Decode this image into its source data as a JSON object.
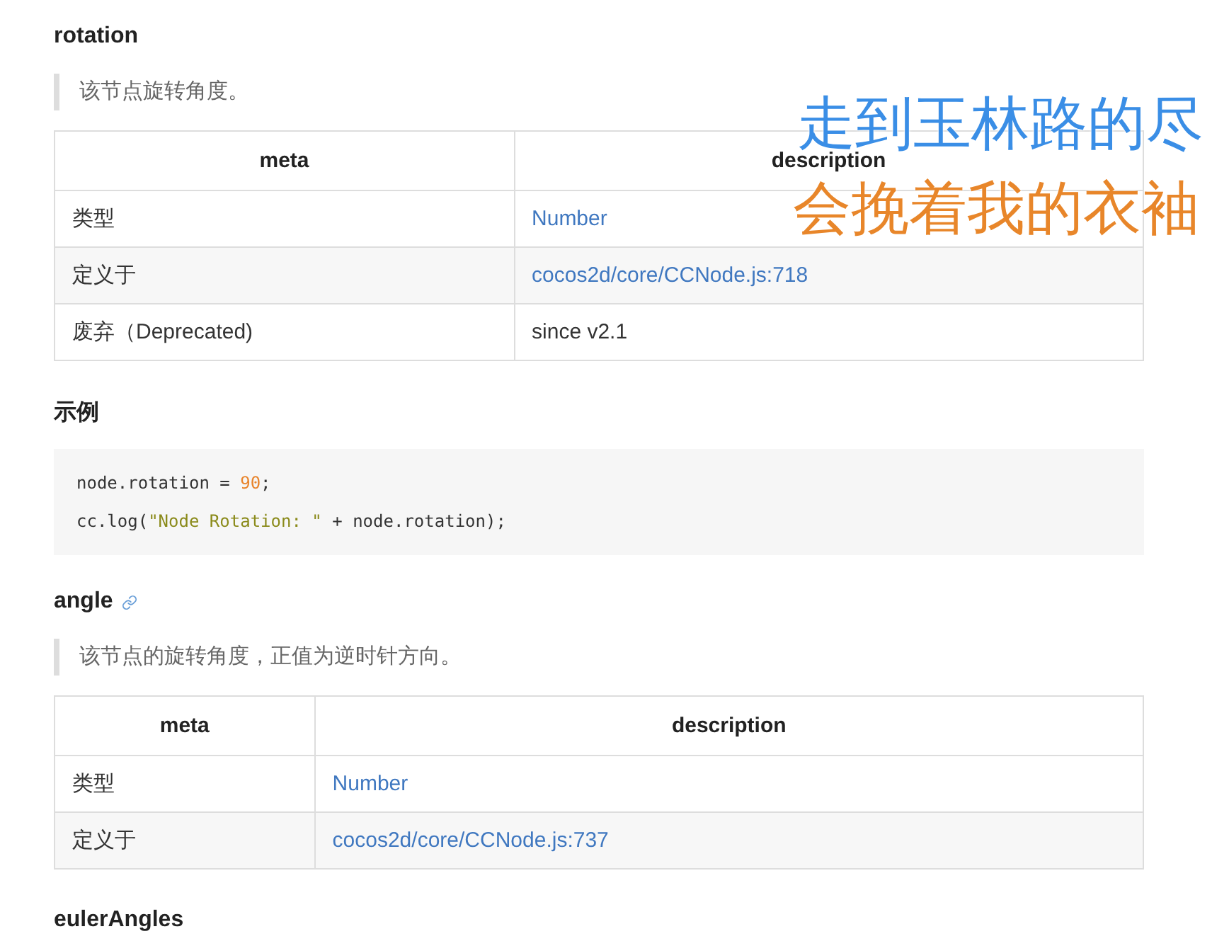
{
  "sections": [
    {
      "heading": "rotation",
      "link_icon": false,
      "quote": "该节点旋转角度。",
      "table": {
        "columns": [
          "meta",
          "description"
        ],
        "rows": [
          {
            "label": "类型",
            "value": "Number",
            "kind": "link"
          },
          {
            "label": "定义于",
            "value": "cocos2d/core/CCNode.js:718",
            "kind": "link"
          },
          {
            "label": "废弃（Deprecated)",
            "value": "since v2.1",
            "kind": "text"
          }
        ]
      },
      "example": {
        "heading": "示例",
        "lines": [
          [
            {
              "kind": "plain",
              "text": "node.rotation = "
            },
            {
              "kind": "number",
              "text": "90"
            },
            {
              "kind": "plain",
              "text": ";"
            }
          ],
          [
            {
              "kind": "plain",
              "text": "cc.log("
            },
            {
              "kind": "string",
              "text": "\"Node Rotation: \""
            },
            {
              "kind": "plain",
              "text": " + node.rotation);"
            }
          ]
        ]
      }
    },
    {
      "heading": "angle",
      "link_icon": true,
      "quote": "该节点的旋转角度，正值为逆时针方向。",
      "table": {
        "columns": [
          "meta",
          "description"
        ],
        "rows": [
          {
            "label": "类型",
            "value": "Number",
            "kind": "link"
          },
          {
            "label": "定义于",
            "value": "cocos2d/core/CCNode.js:737",
            "kind": "link"
          }
        ]
      }
    },
    {
      "heading": "eulerAngles",
      "link_icon": false
    }
  ],
  "lyrics": [
    {
      "text": "走到玉林路的尽",
      "color": "#3a8ee6"
    },
    {
      "text": "会挽着我的衣袖",
      "color": "#e8862a"
    }
  ]
}
